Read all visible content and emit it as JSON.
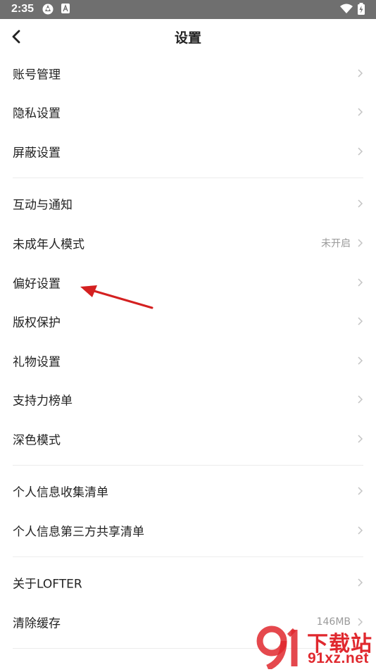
{
  "status_bar": {
    "time": "2:35"
  },
  "header": {
    "title": "设置"
  },
  "groups": [
    {
      "items": [
        {
          "label": "账号管理"
        },
        {
          "label": "隐私设置"
        },
        {
          "label": "屏蔽设置"
        }
      ]
    },
    {
      "items": [
        {
          "label": "互动与通知"
        },
        {
          "label": "未成年人模式",
          "value": "未开启"
        },
        {
          "label": "偏好设置"
        },
        {
          "label": "版权保护"
        },
        {
          "label": "礼物设置"
        },
        {
          "label": "支持力榜单"
        },
        {
          "label": "深色模式"
        }
      ]
    },
    {
      "items": [
        {
          "label": "个人信息收集清单"
        },
        {
          "label": "个人信息第三方共享清单"
        }
      ]
    },
    {
      "items": [
        {
          "label": "关于LOFTER"
        },
        {
          "label": "清除缓存",
          "value": "146MB"
        }
      ]
    }
  ],
  "watermark": {
    "brand": "下载站",
    "domain": "91xz.net"
  },
  "colors": {
    "annotation_arrow": "#d42020",
    "watermark": "#e0282e",
    "divider": "#ececec"
  }
}
